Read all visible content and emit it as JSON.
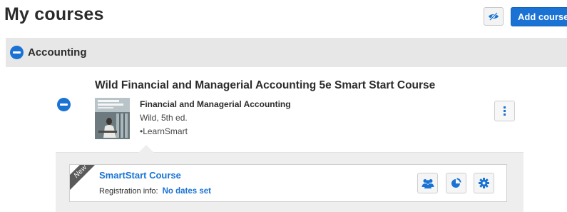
{
  "header": {
    "title": "My courses",
    "visibility_icon": "eye-slash-icon",
    "add_course_label": "Add course"
  },
  "section": {
    "name": "Accounting",
    "collapse_icon": "minus-circle-icon"
  },
  "course": {
    "title": "Wild Financial and Managerial Accounting 5e Smart Start Course",
    "book": {
      "title": "Financial and Managerial Accounting",
      "author_edition": "Wild, 5th ed.",
      "product": "•LearnSmart"
    },
    "more_icon": "vertical-dots-icon"
  },
  "section_card": {
    "ribbon": "New",
    "title": "SmartStart Course",
    "registration_label": "Registration info:",
    "registration_value": "No dates set",
    "actions": [
      "users-icon",
      "reports-pie-icon",
      "settings-gear-icon"
    ]
  },
  "colors": {
    "accent": "#1a73d4",
    "section_bar": "#e7e7e7",
    "panel": "#eeeeee",
    "ribbon": "#5a5a5a"
  }
}
